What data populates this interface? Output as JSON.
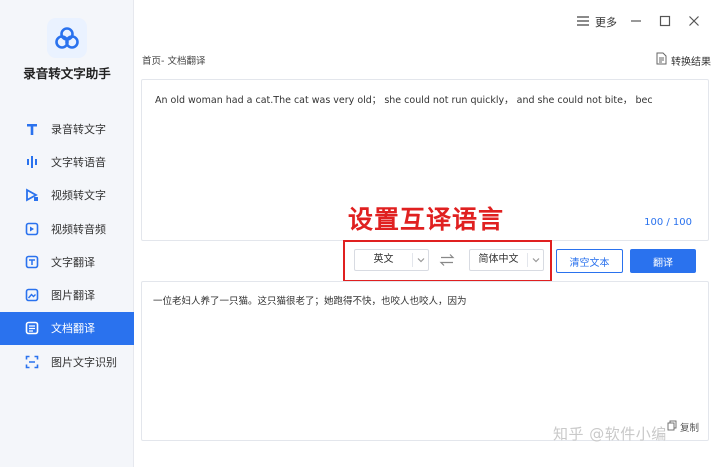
{
  "app": {
    "name": "录音转文字助手"
  },
  "sidebar": {
    "items": [
      {
        "label": "录音转文字",
        "icon": "text-t-icon",
        "active": false
      },
      {
        "label": "文字转语音",
        "icon": "audio-wave-icon",
        "active": false
      },
      {
        "label": "视频转文字",
        "icon": "video-text-icon",
        "active": false
      },
      {
        "label": "视频转音频",
        "icon": "video-audio-icon",
        "active": false
      },
      {
        "label": "文字翻译",
        "icon": "text-translate-icon",
        "active": false
      },
      {
        "label": "图片翻译",
        "icon": "image-translate-icon",
        "active": false
      },
      {
        "label": "文档翻译",
        "icon": "document-translate-icon",
        "active": true
      },
      {
        "label": "图片文字识别",
        "icon": "ocr-scan-icon",
        "active": false
      }
    ]
  },
  "topbar": {
    "more_label": "更多"
  },
  "breadcrumb": "首页- 文档翻译",
  "result_label": "转换结果",
  "source": {
    "text": "An old woman had a cat.The cat was very old；  she could not run quickly，  and she could not bite，  bec",
    "counter": "100 / 100"
  },
  "annotation": "设置互译语言",
  "languages": {
    "source": "英文",
    "target": "简体中文"
  },
  "buttons": {
    "clear": "清空文本",
    "translate": "翻译",
    "copy": "复制"
  },
  "target": {
    "text": "一位老妇人养了一只猫。这只猫很老了；她跑得不快，也咬人也咬人，因为"
  },
  "watermark": "知乎 @软件小编",
  "colors": {
    "accent": "#2a72ee",
    "annotation_red": "#e02020",
    "sidebar_bg": "#f4f6fa"
  }
}
